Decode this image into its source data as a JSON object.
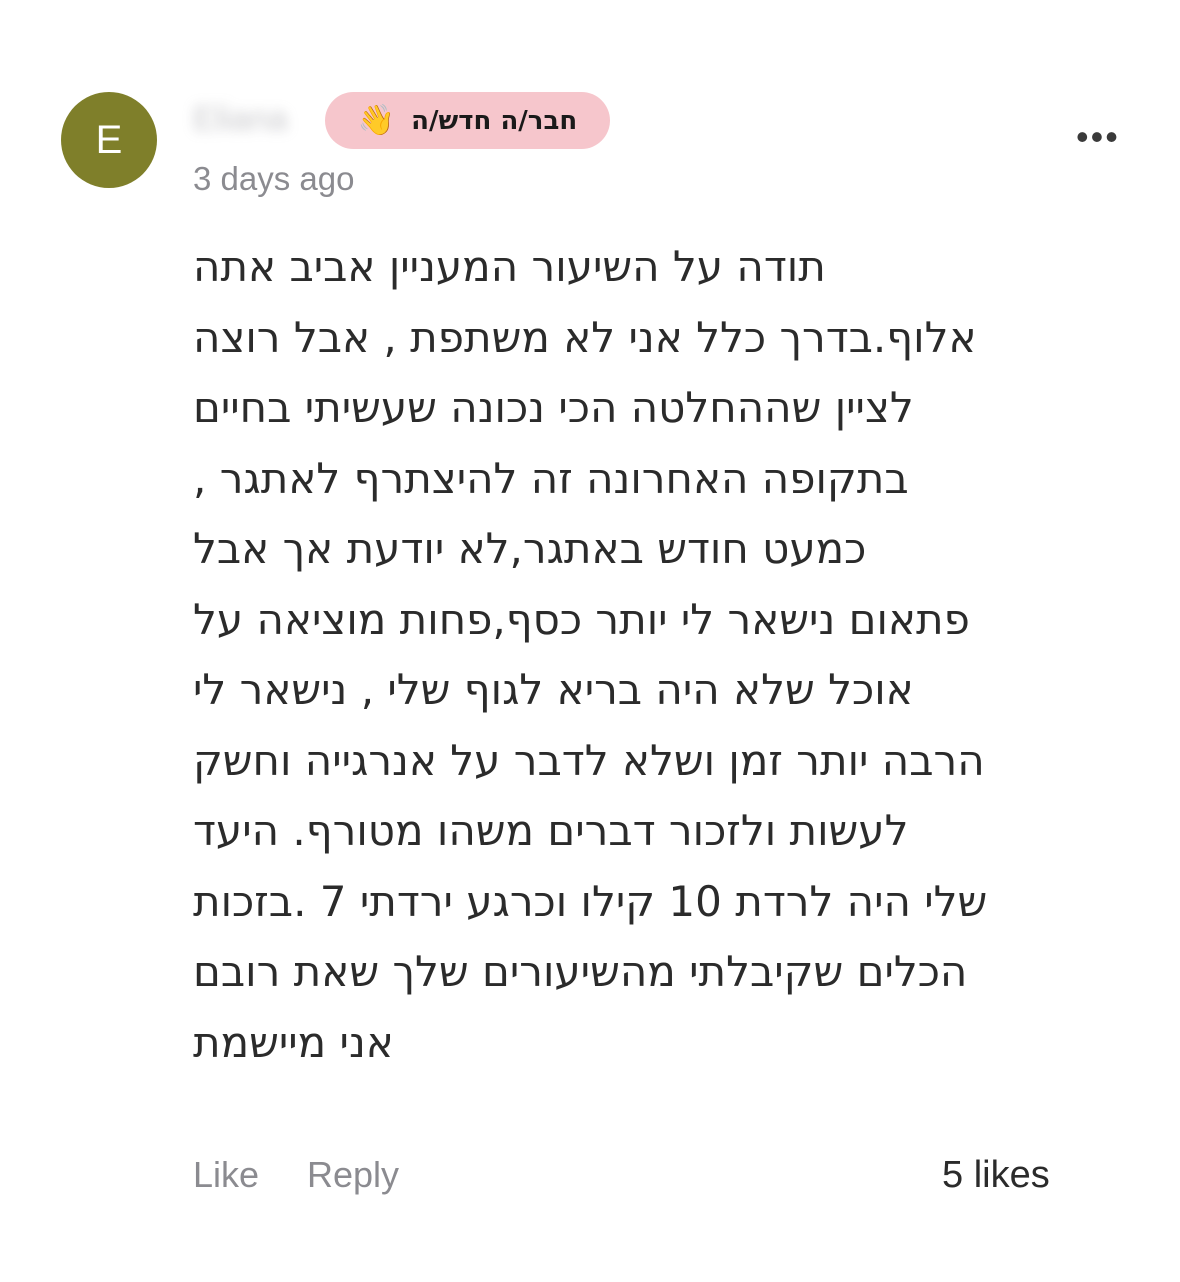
{
  "comment": {
    "avatar_letter": "E",
    "author": "Eliana",
    "badge_label": "חבר/ה חדש/ה",
    "badge_icon": "waving-hand-icon",
    "timestamp": "3 days ago",
    "more_menu": "•••",
    "body_lines": [
      "תודה על השיעור המעניין אביב אתה",
      "אלוף.בדרך כלל אני לא משתפת , אבל רוצה",
      "לציין שההחלטה הכי נכונה שעשיתי בחיים",
      "בתקופה האחרונה זה להיצתרף לאתגר ,",
      "כמעט חודש באתגר,לא יודעת אך אבל",
      "פתאום נישאר לי יותר כסף,פחות מוציאה על",
      "אוכל שלא היה בריא לגוף שלי , נישאר לי",
      "הרבה יותר זמן ושלא לדבר על אנרגייה וחשק",
      "לעשות ולזכור דברים משהו מטורף. היעד",
      "שלי היה לרדת 10 קילו וכרגע ירדתי 7 .בזכות",
      "הכלים שקיבלתי מהשיעורים שלך שאת רובם",
      "אני מיישמת"
    ],
    "like_label": "Like",
    "reply_label": "Reply",
    "likes_count": "5 likes"
  },
  "colors": {
    "avatar_bg": "#7f7f2a",
    "badge_bg": "#f6c6cc",
    "muted_text": "#8b8b90"
  }
}
